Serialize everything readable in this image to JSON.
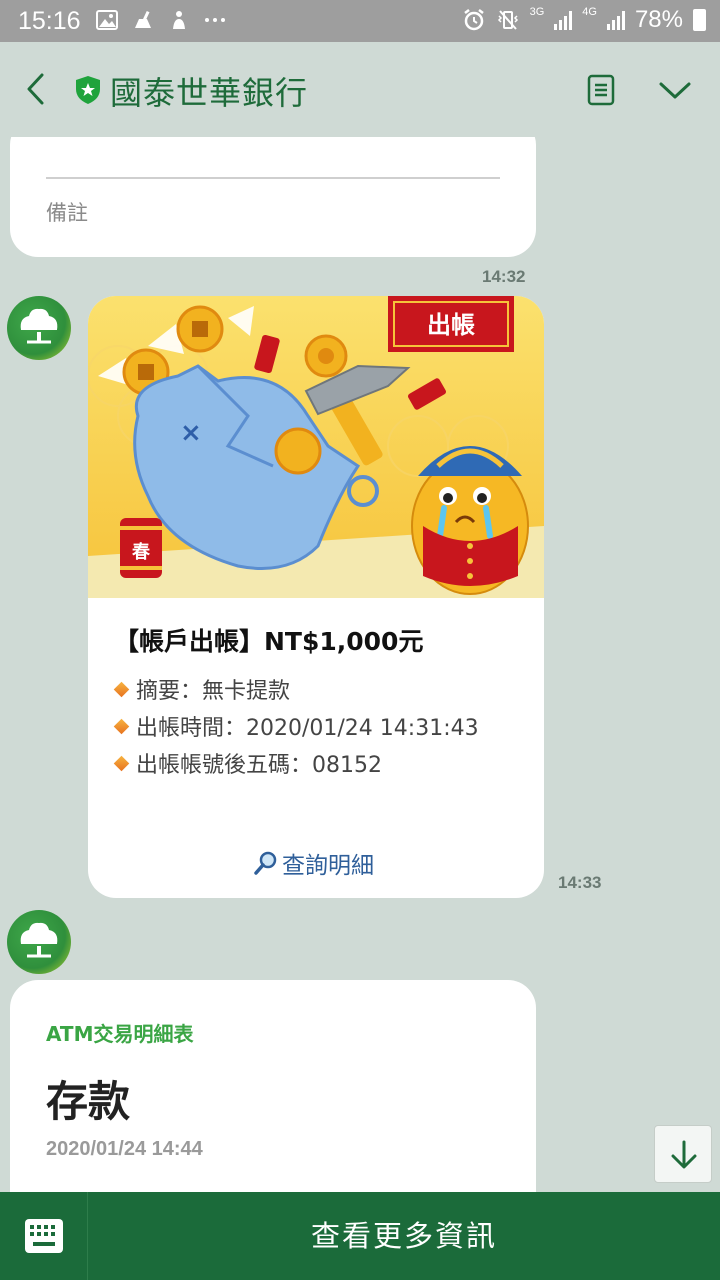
{
  "status_bar": {
    "time": "15:16",
    "left_icons": [
      "image-icon",
      "broom-icon",
      "figure-icon",
      "more-icon"
    ],
    "network_1": "3G",
    "network_2": "4G",
    "battery": "78%"
  },
  "header": {
    "title": "國泰世華銀行",
    "back_icon": "chevron-left-icon",
    "badge_icon": "shield-star-icon",
    "note_icon": "note-icon",
    "menu_icon": "chevron-down-icon"
  },
  "messages": {
    "partial_card": {
      "label": "備註",
      "time": "14:32"
    },
    "withdrawal_card": {
      "banner_tag": "出帳",
      "firecracker_char": "春",
      "title": "【帳戶出帳】NT$1,000元",
      "items": [
        "摘要：無卡提款",
        "出帳時間：2020/01/24 14:31:43",
        "出帳帳號後五碼：08152"
      ],
      "link": "查詢明細",
      "time": "14:33"
    },
    "atm_card": {
      "subtitle": "ATM交易明細表",
      "title": "存款",
      "time": "2020/01/24 14:44"
    }
  },
  "bottom_bar": {
    "label": "查看更多資訊",
    "keyboard_icon": "keyboard-icon"
  },
  "colors": {
    "brand_green": "#1b6b3a",
    "accent_green": "#3aa544",
    "chat_bg": "#cfdad5"
  }
}
